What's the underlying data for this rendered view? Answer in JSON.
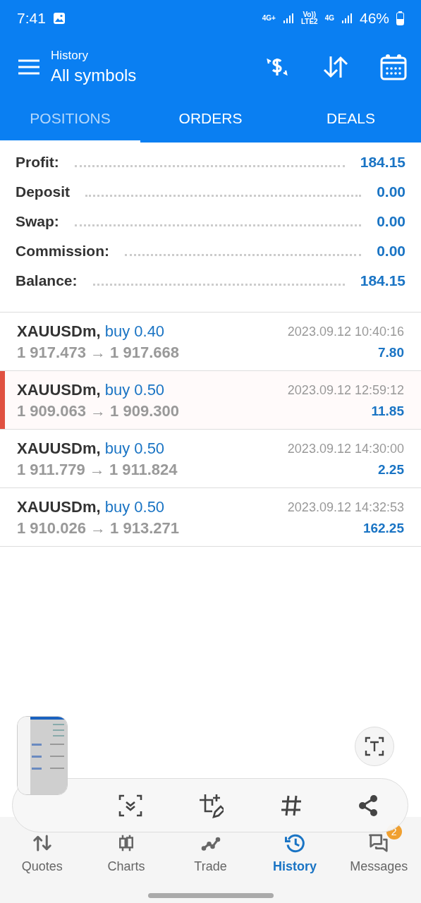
{
  "status_bar": {
    "time": "7:41",
    "network_1": "4G+",
    "network_2": "Vo))",
    "network_3": "LTE2",
    "network_4": "4G",
    "battery": "46%"
  },
  "app_bar": {
    "subtitle": "History",
    "title": "All symbols"
  },
  "tabs": [
    {
      "label": "POSITIONS",
      "selected": true
    },
    {
      "label": "ORDERS",
      "selected": false
    },
    {
      "label": "DEALS",
      "selected": false
    }
  ],
  "summary": [
    {
      "label": "Profit:",
      "value": "184.15"
    },
    {
      "label": "Deposit",
      "value": "0.00"
    },
    {
      "label": "Swap:",
      "value": "0.00"
    },
    {
      "label": "Commission:",
      "value": "0.00"
    },
    {
      "label": "Balance:",
      "value": "184.15"
    }
  ],
  "trades": [
    {
      "symbol": "XAUUSDm,",
      "side": "buy 0.40",
      "prices": "1 917.473 → 1 917.668",
      "time": "2023.09.12 10:40:16",
      "profit": "7.80",
      "highlighted": false
    },
    {
      "symbol": "XAUUSDm,",
      "side": "buy 0.50",
      "prices": "1 909.063 → 1 909.300",
      "time": "2023.09.12 12:59:12",
      "profit": "11.85",
      "highlighted": true
    },
    {
      "symbol": "XAUUSDm,",
      "side": "buy 0.50",
      "prices": "1 911.779 → 1 911.824",
      "time": "2023.09.12 14:30:00",
      "profit": "2.25",
      "highlighted": false
    },
    {
      "symbol": "XAUUSDm,",
      "side": "buy 0.50",
      "prices": "1 910.026 → 1 913.271",
      "time": "2023.09.12 14:32:53",
      "profit": "162.25",
      "highlighted": false
    }
  ],
  "nav": [
    {
      "label": "Quotes",
      "selected": false
    },
    {
      "label": "Charts",
      "selected": false
    },
    {
      "label": "Trade",
      "selected": false
    },
    {
      "label": "History",
      "selected": true
    },
    {
      "label": "Messages",
      "selected": false,
      "badge": "2"
    }
  ]
}
